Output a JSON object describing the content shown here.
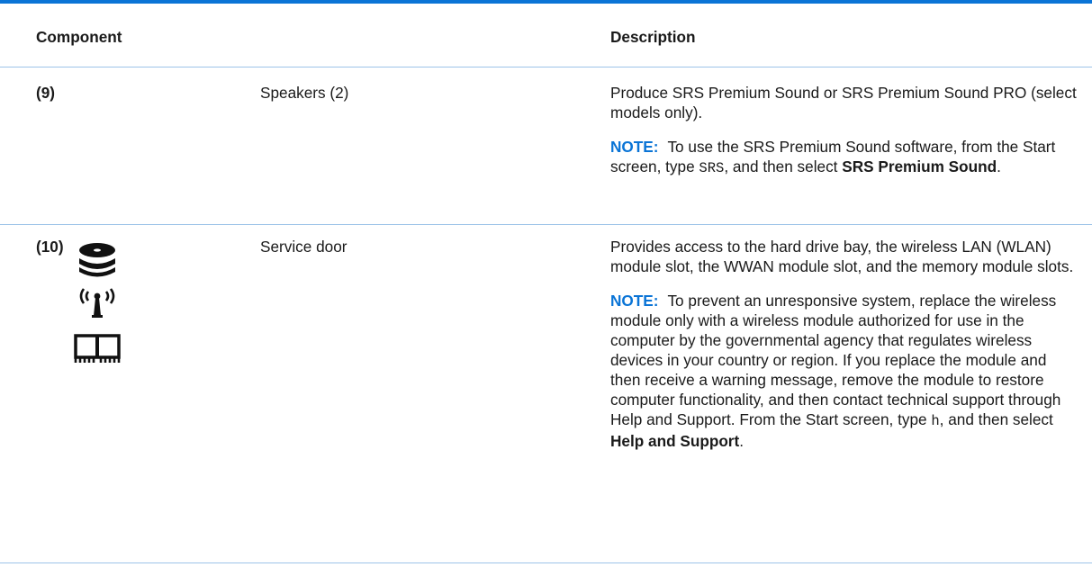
{
  "table": {
    "headers": {
      "component": "Component",
      "description": "Description"
    },
    "rows": [
      {
        "number": "(9)",
        "name": "Speakers (2)",
        "description": "Produce SRS Premium Sound or SRS Premium Sound PRO (select models only).",
        "note": {
          "label": "NOTE:",
          "text1": "To use the SRS Premium Sound software, from the Start screen, type",
          "code": "SRS",
          "text2": ", and then select",
          "bold": "SRS Premium Sound",
          "end": "."
        }
      },
      {
        "number": "(10)",
        "icons": [
          "hard-drive-icon",
          "wireless-antenna-icon",
          "memory-module-icon"
        ],
        "name": "Service door",
        "description": "Provides access to the hard drive bay, the wireless LAN (WLAN) module slot, the WWAN module slot, and the memory module slots.",
        "note": {
          "label": "NOTE:",
          "text1": "To prevent an unresponsive system, replace the wireless module only with a wireless module authorized for use in the computer by the governmental agency that regulates wireless devices in your country or region. If you replace the module and then receive a warning message, remove the module to restore computer functionality, and then contact technical support through Help and Support. From the Start screen, type",
          "code": "h",
          "text2": ", and then select",
          "bold": "Help and Support",
          "end": "."
        }
      }
    ]
  },
  "colors": {
    "accent": "#0a74d6",
    "rule": "#9cc3e8",
    "text": "#1a1a1a"
  }
}
